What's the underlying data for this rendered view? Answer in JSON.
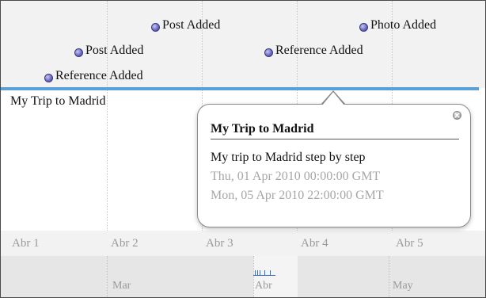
{
  "timeline": {
    "events": [
      {
        "label": "Post Added"
      },
      {
        "label": "Photo Added"
      },
      {
        "label": "Post Added"
      },
      {
        "label": "Reference Added"
      },
      {
        "label": "Reference Added"
      }
    ],
    "duration_event": {
      "label": "My Trip to Madrid",
      "color": "#5aa0d8"
    },
    "tick_labels": [
      "Abr 1",
      "Abr 2",
      "Abr 3",
      "Abr 4",
      "Abr 5"
    ]
  },
  "overview": {
    "month_labels": [
      "Mar",
      "Abr",
      "May"
    ]
  },
  "bubble": {
    "title": "My Trip to Madrid",
    "description": "My trip to Madrid step by step",
    "start": "Thu, 01 Apr 2010 00:00:00 GMT",
    "end": "Mon, 05 Apr 2010 22:00:00 GMT",
    "close_icon": "close-icon"
  }
}
